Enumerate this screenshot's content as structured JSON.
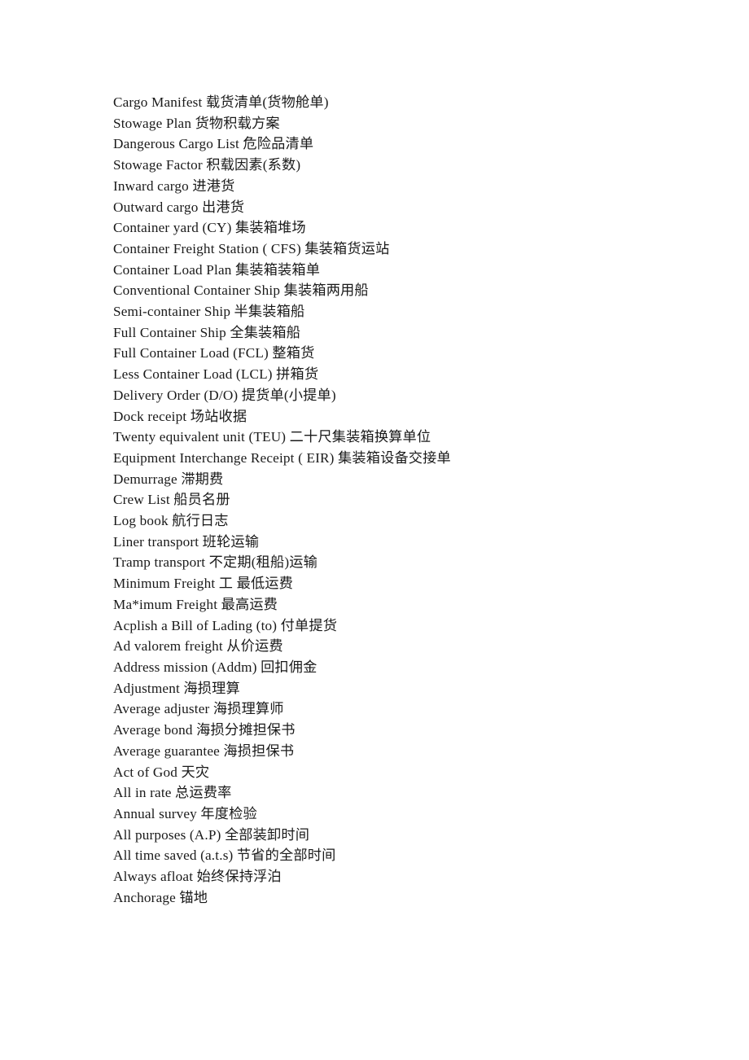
{
  "document": {
    "type": "glossary",
    "language": "en-zh",
    "page_background": "#ffffff",
    "text_color": "#1a1a1a",
    "entries": [
      "Cargo Manifest 载货清单(货物舱单)",
      "Stowage Plan 货物积载方案",
      "Dangerous Cargo List 危险品清单",
      "Stowage Factor 积载因素(系数)",
      "Inward cargo 进港货",
      "Outward cargo 出港货",
      "Container yard (CY) 集装箱堆场",
      "Container Freight Station ( CFS) 集装箱货运站",
      "Container Load Plan 集装箱装箱单",
      "Conventional Container Ship 集装箱两用船",
      "Semi-container Ship 半集装箱船",
      "Full Container Ship 全集装箱船",
      "Full Container Load (FCL) 整箱货",
      "Less Container Load (LCL) 拼箱货",
      "Delivery Order (D/O) 提货单(小提单)",
      "Dock receipt 场站收据",
      "Twenty equivalent unit (TEU) 二十尺集装箱换算单位",
      "Equipment Interchange Receipt ( EIR) 集装箱设备交接单",
      "Demurrage 滞期费",
      "Crew List 船员名册",
      "Log book 航行日志",
      "Liner transport 班轮运输",
      "Tramp transport 不定期(租船)运输",
      "Minimum Freight 工 最低运费",
      "Ma*imum Freight 最高运费",
      "Acplish a Bill of Lading (to) 付单提货",
      "Ad valorem freight 从价运费",
      "Address mission (Addm) 回扣佣金",
      "Adjustment 海损理算",
      "Average adjuster 海损理算师",
      "Average bond 海损分摊担保书",
      "Average guarantee 海损担保书",
      "Act of God 天灾",
      "All in rate 总运费率",
      "Annual survey 年度检验",
      "All purposes (A.P) 全部装卸时间",
      "All time saved (a.t.s) 节省的全部时间",
      "Always afloat 始终保持浮泊",
      "Anchorage 锚地"
    ]
  }
}
